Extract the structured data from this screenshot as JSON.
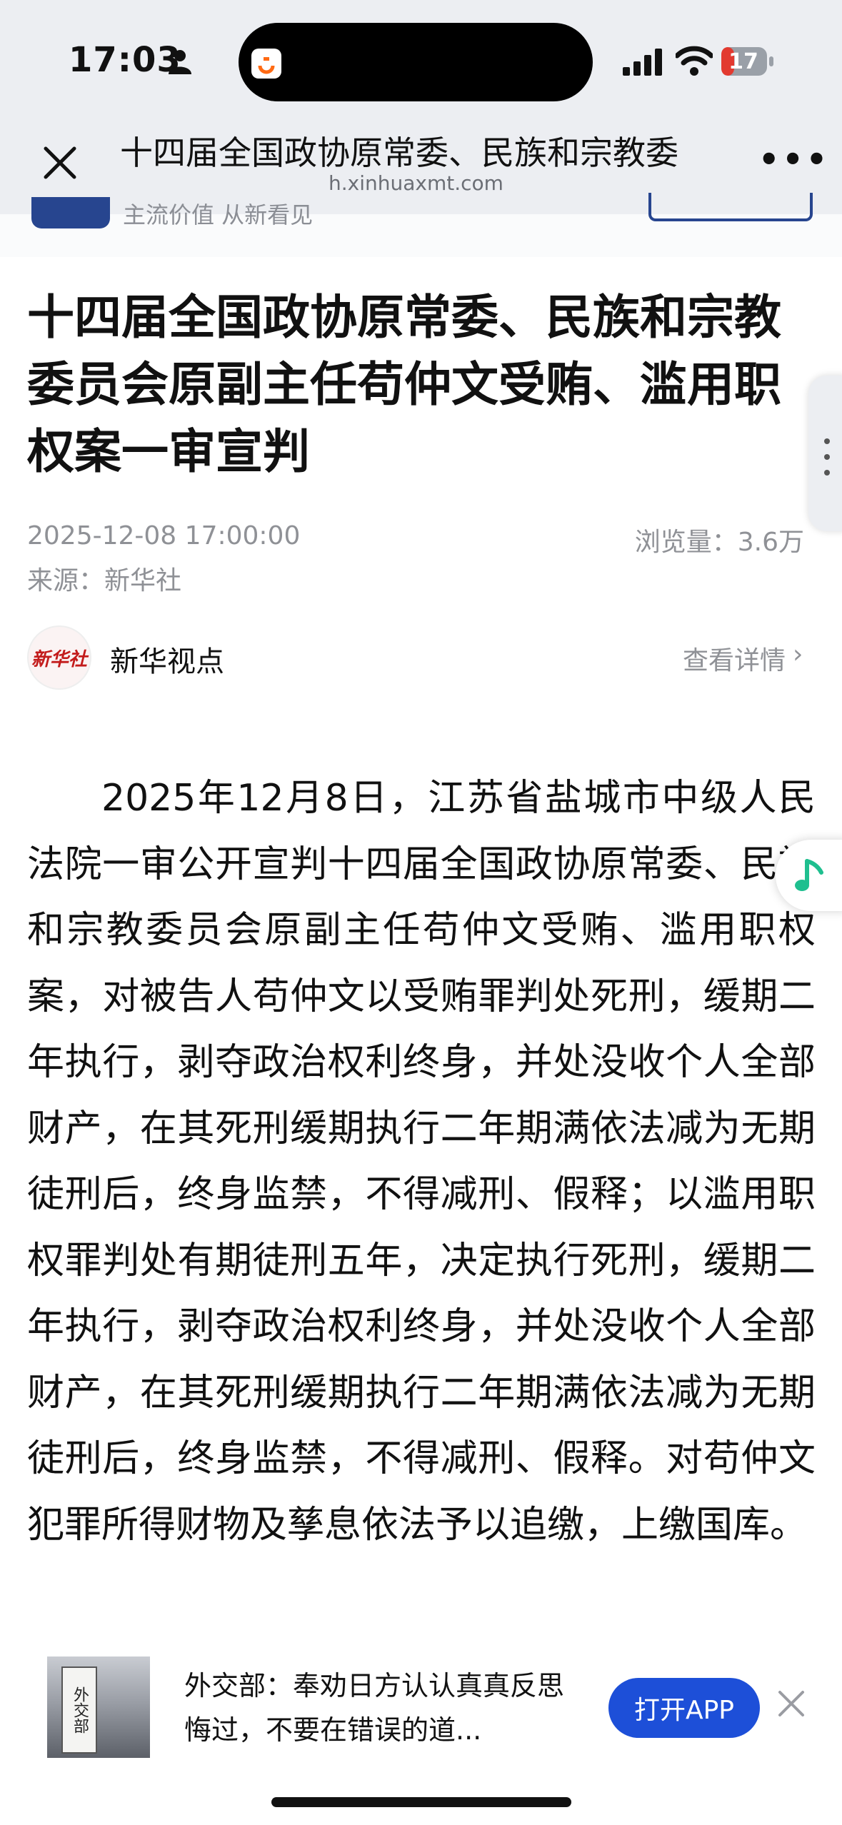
{
  "status_bar": {
    "time": "17:03",
    "battery": "17"
  },
  "nav": {
    "title": "十四届全国政协原常委、民族和宗教委",
    "domain": "h.xinhuaxmt.com",
    "more": "•••"
  },
  "peek": {
    "slogan": "主流价值 从新看见"
  },
  "article": {
    "headline": "十四届全国政协原常委、民族和宗教委员会原副主任苟仲文受贿、滥用职权案一审宣判",
    "date": "2025-12-08 17:00:00",
    "views": "浏览量：3.6万",
    "source": "来源：新华社",
    "account": {
      "avatar_text": "新华社",
      "name": "新华视点",
      "link": "查看详情",
      "chevron": "›"
    },
    "body": "2025年12月8日，江苏省盐城市中级人民法院一审公开宣判十四届全国政协原常委、民族和宗教委员会原副主任苟仲文受贿、滥用职权案，对被告人苟仲文以受贿罪判处死刑，缓期二年执行，剥夺政治权利终身，并处没收个人全部财产，在其死刑缓期执行二年期满依法减为无期徒刑后，终身监禁，不得减刑、假释；以滥用职权罪判处有期徒刑五年，决定执行死刑，缓期二年执行，剥夺政治权利终身，并处没收个人全部财产，在其死刑缓期执行二年期满依法减为无期徒刑后，终身监禁，不得减刑、假释。对苟仲文犯罪所得财物及孳息依法予以追缴，上缴国库。"
  },
  "banner": {
    "thumb_sign": "外交部",
    "title": "外交部：奉劝日方认认真真反思悔过，不要在错误的道...",
    "open_app": "打开APP"
  },
  "colors": {
    "brand_blue": "#1d4fd8",
    "header_bg": "#eceef2",
    "meta_gray": "#8f9196"
  },
  "icons": [
    "person-icon",
    "didi-icon",
    "signal-icon",
    "wifi-icon",
    "battery-icon",
    "close-icon",
    "more-icon",
    "chevron-right-icon",
    "music-note-icon",
    "close-icon"
  ]
}
